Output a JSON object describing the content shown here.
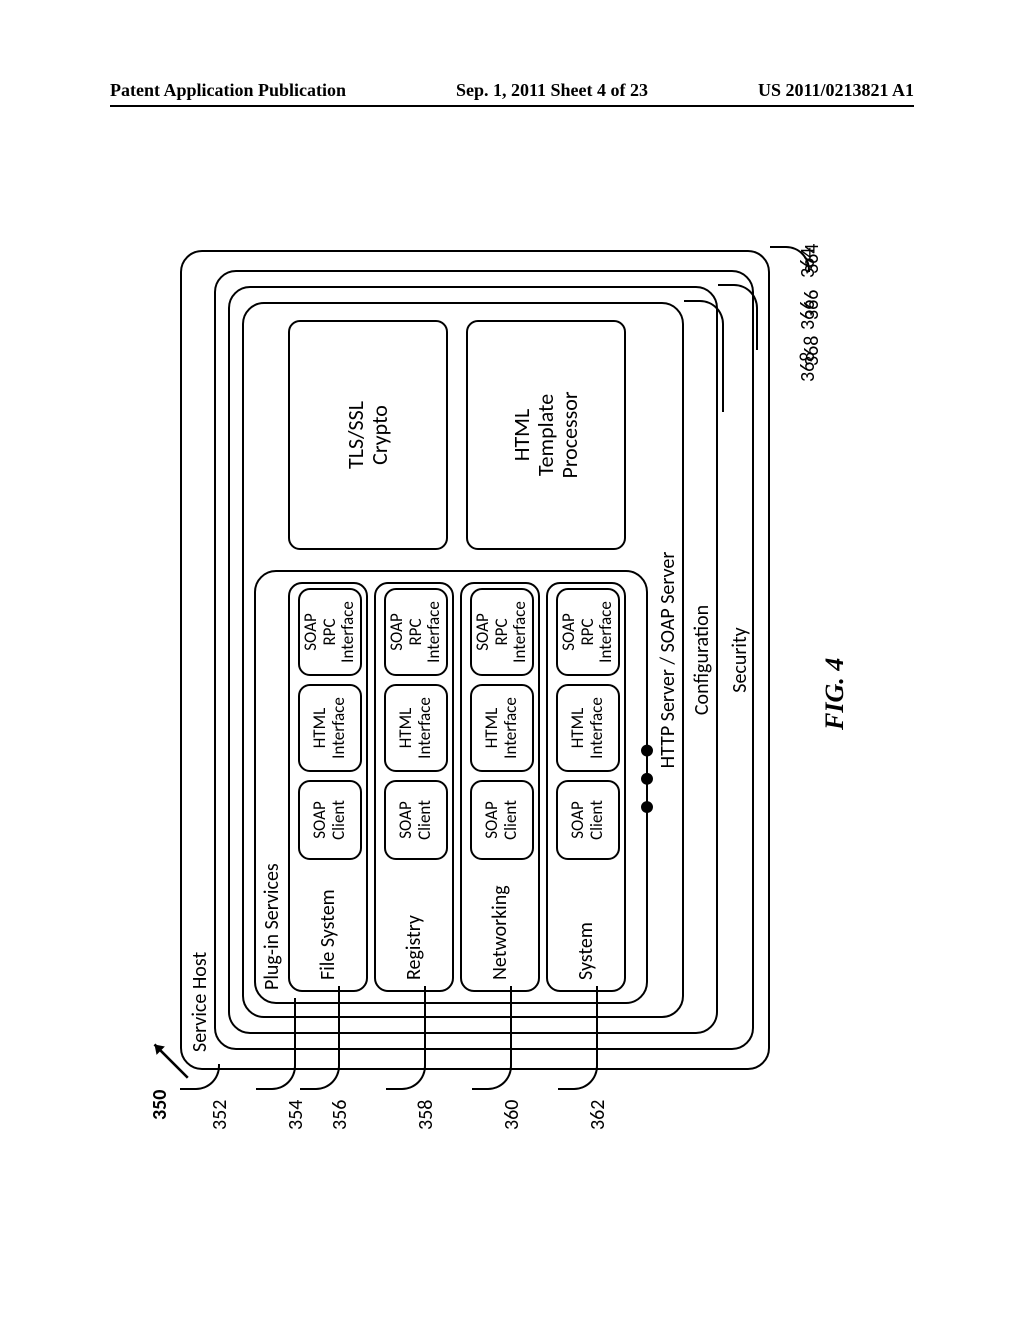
{
  "header": {
    "left": "Patent Application Publication",
    "center": "Sep. 1, 2011  Sheet 4 of 23",
    "right": "US 2011/0213821 A1"
  },
  "refs": {
    "r350": "350",
    "r352": "352",
    "r354": "354",
    "r356": "356",
    "r358": "358",
    "r360": "360",
    "r362": "362",
    "r364": "364",
    "r366": "366",
    "r368": "368"
  },
  "labels": {
    "service_host": "Service Host",
    "security": "Security",
    "configuration": "Configuration",
    "http_soap": "HTTP Server / SOAP Server",
    "plugins": "Plug-in Services"
  },
  "services": [
    {
      "name": "File System"
    },
    {
      "name": "Registry"
    },
    {
      "name": "Networking"
    },
    {
      "name": "System"
    }
  ],
  "service_subs": {
    "soap_client": "SOAP\nClient",
    "html_if": "HTML\nInterface",
    "soap_rpc": "SOAP\nRPC\nInterface"
  },
  "side_blocks": {
    "tls": "TLS/SSL\nCrypto",
    "html_tpl": "HTML\nTemplate\nProcessor"
  },
  "ellipsis": "• • •",
  "figure_caption": "FIG. 4"
}
